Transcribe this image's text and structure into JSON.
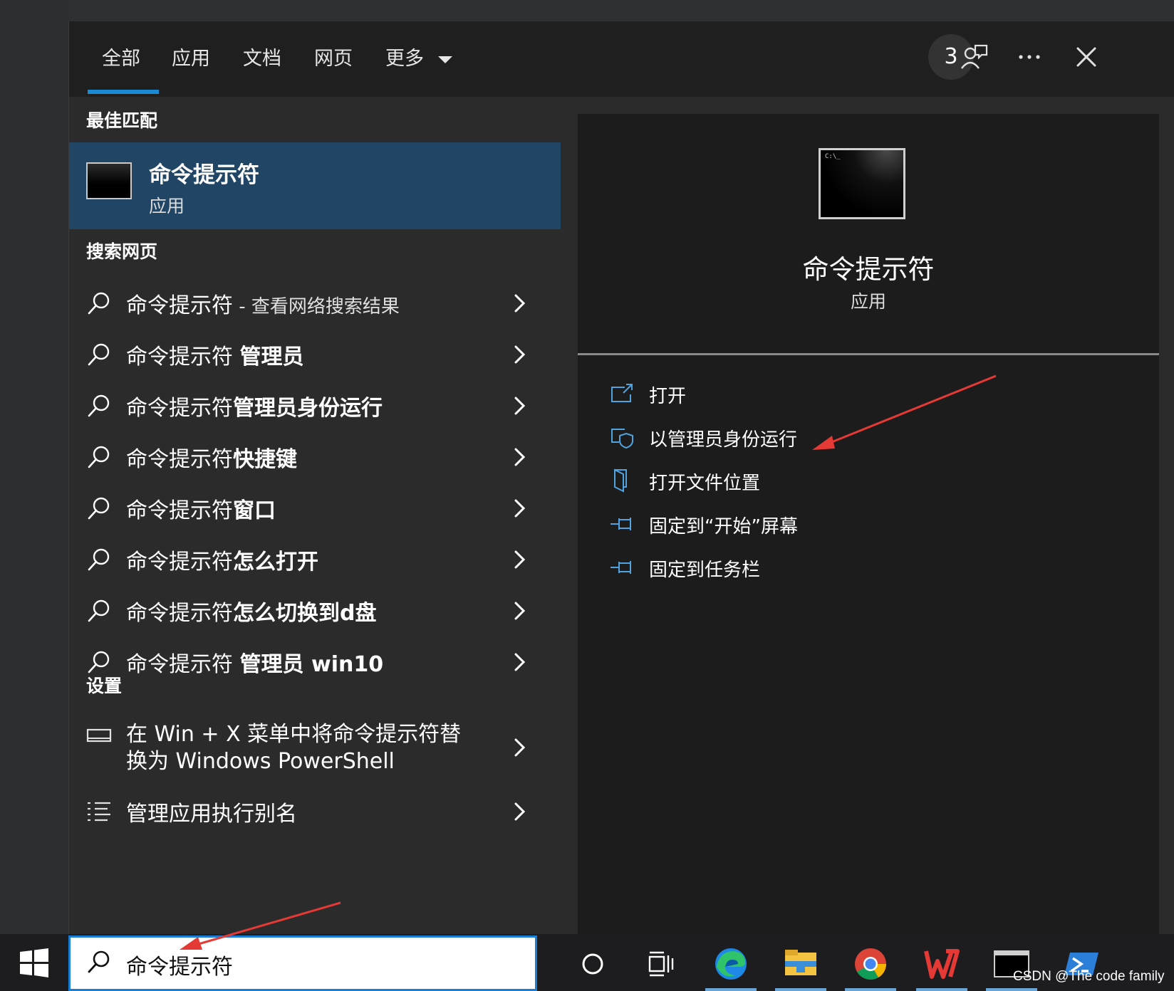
{
  "tabs": [
    "全部",
    "应用",
    "文档",
    "网页",
    "更多"
  ],
  "badge_count": "3",
  "best_match": {
    "section_title": "最佳匹配",
    "title": "命令提示符",
    "subtitle": "应用"
  },
  "web_section_title": "搜索网页",
  "web_results": [
    {
      "query": "命令提示符",
      "rest": "",
      "suffix": " - 查看网络搜索结果"
    },
    {
      "query": "命令提示符 ",
      "rest": "管理员",
      "suffix": ""
    },
    {
      "query": "命令提示符",
      "rest": "管理员身份运行",
      "suffix": ""
    },
    {
      "query": "命令提示符",
      "rest": "快捷键",
      "suffix": ""
    },
    {
      "query": "命令提示符",
      "rest": "窗口",
      "suffix": ""
    },
    {
      "query": "命令提示符",
      "rest": "怎么打开",
      "suffix": ""
    },
    {
      "query": "命令提示符",
      "rest": "怎么切换到d盘",
      "suffix": ""
    },
    {
      "query": "命令提示符 ",
      "rest": "管理员 win10",
      "suffix": ""
    }
  ],
  "settings_section_title": "设置",
  "settings_results": [
    {
      "line1": "在 Win + X 菜单中将命令提示符替",
      "line2": "换为 Windows PowerShell"
    },
    {
      "line1": "管理应用执行别名",
      "line2": ""
    }
  ],
  "detail": {
    "title": "命令提示符",
    "subtitle": "应用",
    "icon_prompt": "C:\\_",
    "actions": [
      "打开",
      "以管理员身份运行",
      "打开文件位置",
      "固定到“开始”屏幕",
      "固定到任务栏"
    ]
  },
  "search": {
    "value": "命令提示符"
  },
  "taskbar_apps": [
    "cortana",
    "task-view",
    "edge",
    "file-explorer",
    "chrome",
    "wps",
    "cmd",
    "powershell"
  ],
  "watermark": "CSDN @The code family",
  "colors": {
    "accent": "#1a8ad4",
    "selected": "#214564",
    "arrow": "#e53935"
  }
}
